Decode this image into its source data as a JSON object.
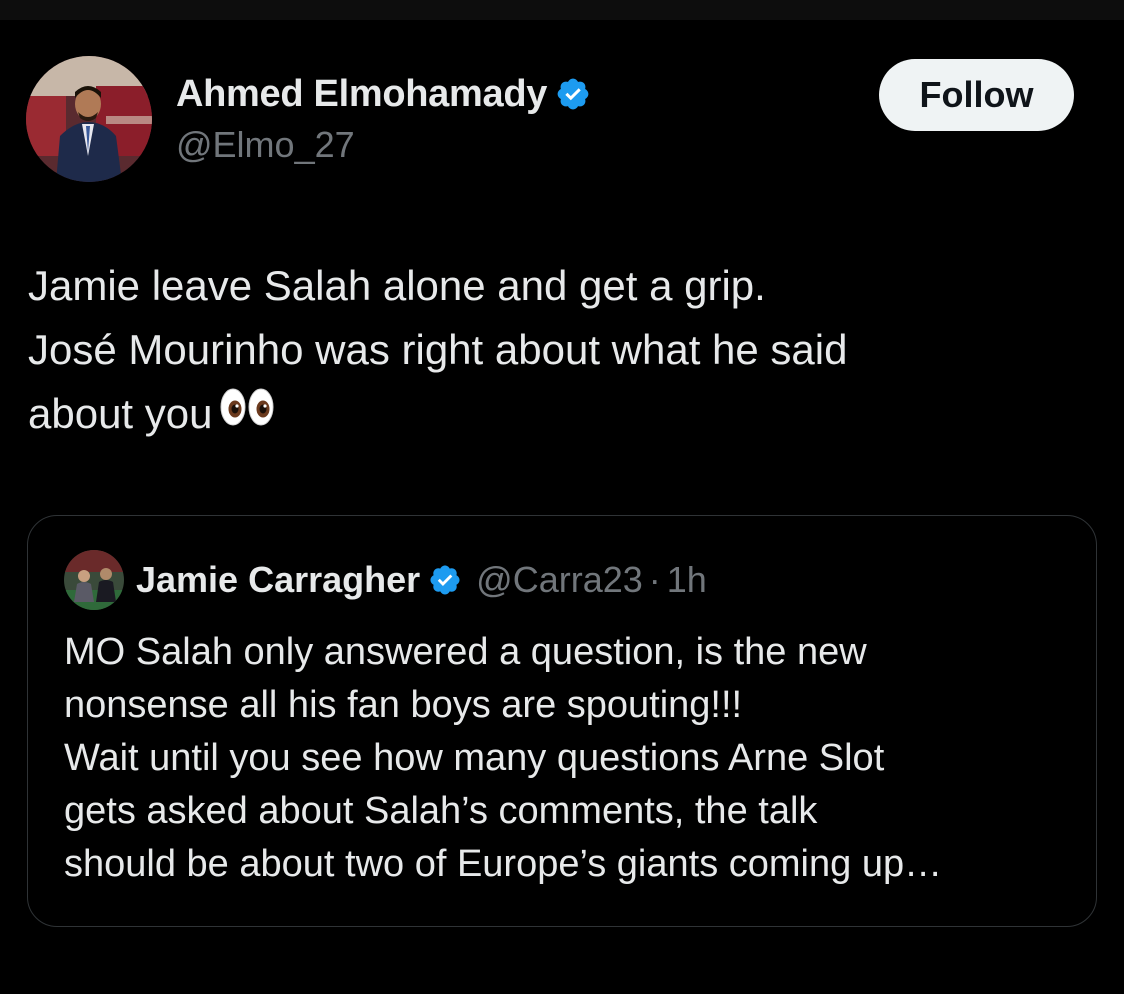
{
  "tweet": {
    "author": {
      "display_name": "Ahmed Elmohamady",
      "handle": "@Elmo_27",
      "verified_icon": "verified-badge-icon",
      "avatar_icon": "profile-photo"
    },
    "follow_label": "Follow",
    "text_lines": [
      "Jamie leave Salah alone and get a grip.",
      "José Mourinho was right about what he said",
      "about you"
    ],
    "emoji": "eyes-emoji"
  },
  "quote": {
    "author": {
      "display_name": "Jamie Carragher",
      "handle": "@Carra23",
      "separator": "·",
      "time": "1h",
      "verified_icon": "verified-badge-icon"
    },
    "text_lines": [
      "MO Salah only answered a question, is the new",
      "nonsense all his fan boys are spouting!!!",
      "Wait until you see how many questions Arne Slot",
      "gets asked about Salah’s comments, the talk",
      "should be about two of Europe’s giants coming up…"
    ]
  },
  "colors": {
    "background": "#000000",
    "text_primary": "#e7e9ea",
    "text_secondary": "#71767b",
    "verified_blue": "#1d9bf0",
    "follow_bg": "#eff3f4",
    "card_border": "#2f3336"
  }
}
